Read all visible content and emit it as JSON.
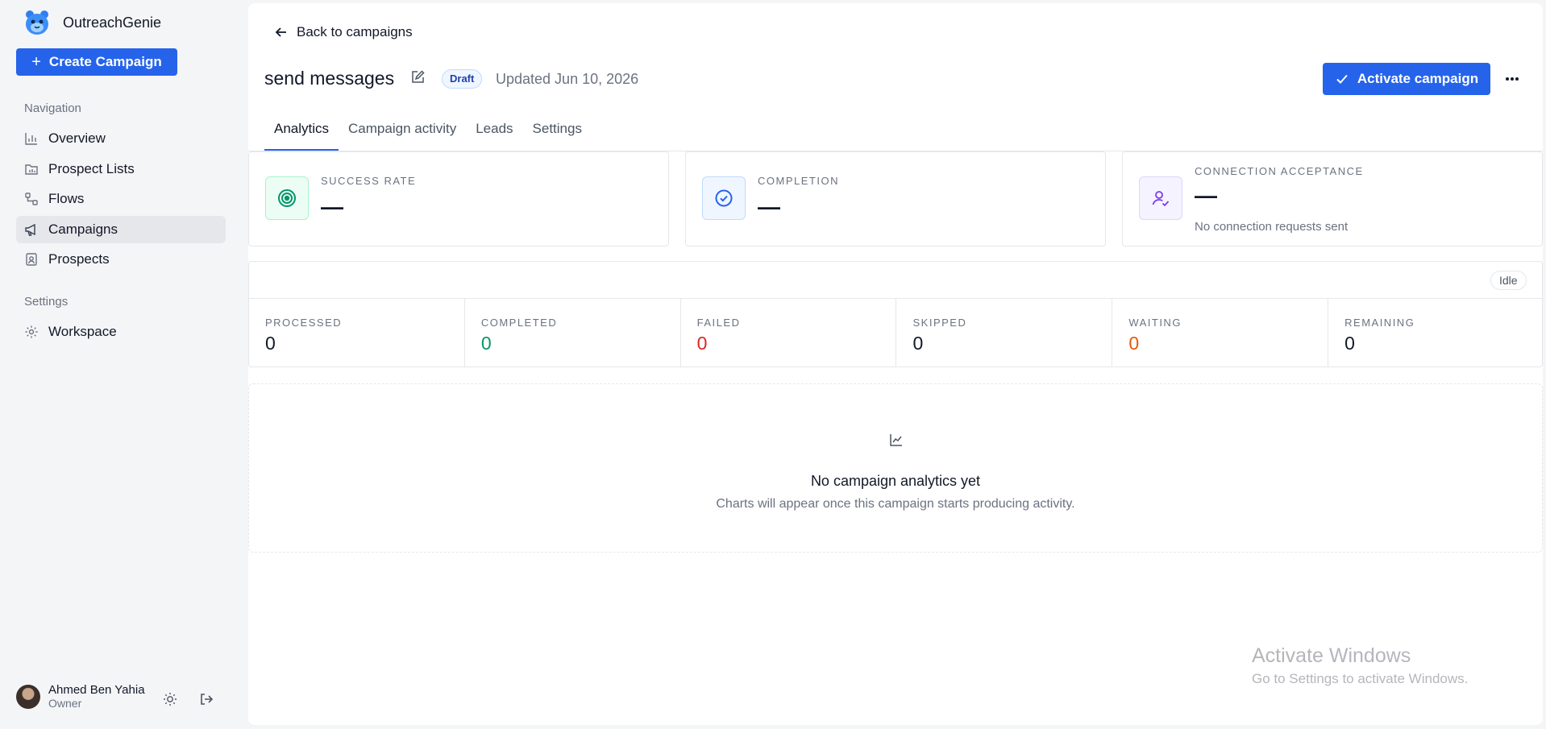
{
  "brand": {
    "name": "OutreachGenie"
  },
  "sidebar": {
    "create_label": "Create Campaign",
    "nav_section": "Navigation",
    "nav_items": [
      {
        "label": "Overview",
        "icon": "bar-chart-icon"
      },
      {
        "label": "Prospect Lists",
        "icon": "folder-chart-icon"
      },
      {
        "label": "Flows",
        "icon": "flow-icon"
      },
      {
        "label": "Campaigns",
        "icon": "megaphone-icon",
        "active": true
      },
      {
        "label": "Prospects",
        "icon": "contact-card-icon"
      }
    ],
    "settings_section": "Settings",
    "settings_items": [
      {
        "label": "Workspace",
        "icon": "gear-icon"
      }
    ]
  },
  "user": {
    "name": "Ahmed Ben Yahia",
    "role": "Owner"
  },
  "header": {
    "back_label": "Back to campaigns",
    "title": "send messages",
    "status": "Draft",
    "updated": "Updated Jun 10, 2026",
    "activate_label": "Activate campaign"
  },
  "tabs": [
    {
      "label": "Analytics",
      "active": true
    },
    {
      "label": "Campaign activity"
    },
    {
      "label": "Leads"
    },
    {
      "label": "Settings"
    }
  ],
  "metrics": [
    {
      "label": "SUCCESS RATE",
      "value": "—",
      "icon": "target-icon"
    },
    {
      "label": "COMPLETION",
      "value": "—",
      "icon": "check-circle-icon"
    },
    {
      "label": "CONNECTION ACCEPTANCE",
      "value": "—",
      "note": "No connection requests sent",
      "icon": "user-check-icon"
    }
  ],
  "stats": {
    "status": "Idle",
    "items": [
      {
        "label": "PROCESSED",
        "value": "0",
        "color": "#111827"
      },
      {
        "label": "COMPLETED",
        "value": "0",
        "color": "#059669"
      },
      {
        "label": "FAILED",
        "value": "0",
        "color": "#dc2626"
      },
      {
        "label": "SKIPPED",
        "value": "0",
        "color": "#111827"
      },
      {
        "label": "WAITING",
        "value": "0",
        "color": "#ea580c"
      },
      {
        "label": "REMAINING",
        "value": "0",
        "color": "#111827"
      }
    ]
  },
  "empty_state": {
    "title": "No campaign analytics yet",
    "subtitle": "Charts will appear once this campaign starts producing activity."
  },
  "watermark": {
    "title": "Activate Windows",
    "subtitle": "Go to Settings to activate Windows."
  },
  "colors": {
    "accent": "#2563eb"
  }
}
